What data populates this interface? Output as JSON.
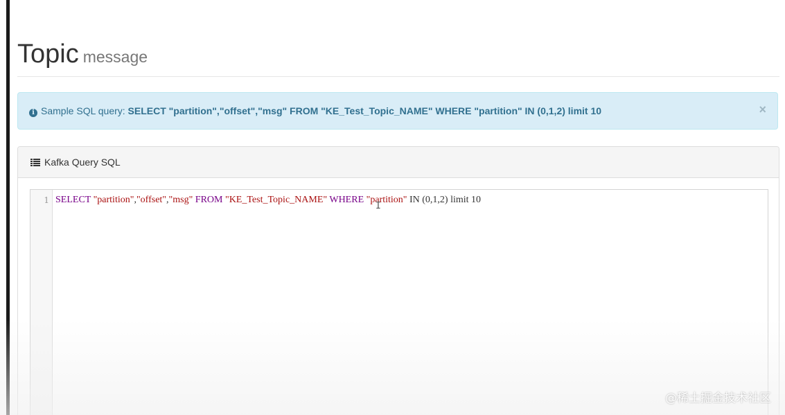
{
  "header": {
    "title": "Topic",
    "subtitle": "message"
  },
  "alert": {
    "icon": "info-circle-icon",
    "label": "Sample SQL query: ",
    "sql": "SELECT \"partition\",\"offset\",\"msg\" FROM \"KE_Test_Topic_NAME\" WHERE \"partition\" IN (0,1,2) limit 10",
    "close": "×",
    "colors": {
      "background": "#d9edf7",
      "border": "#bce8f1",
      "text": "#31708f"
    }
  },
  "panel": {
    "icon": "list-icon",
    "title": "Kafka Query SQL"
  },
  "editor": {
    "line_number": "1",
    "tokens": [
      {
        "text": "SELECT",
        "type": "kw"
      },
      {
        "text": " ",
        "type": "plain"
      },
      {
        "text": "\"partition\"",
        "type": "str"
      },
      {
        "text": ",",
        "type": "plain"
      },
      {
        "text": "\"offset\"",
        "type": "str"
      },
      {
        "text": ",",
        "type": "plain"
      },
      {
        "text": "\"msg\"",
        "type": "str"
      },
      {
        "text": " ",
        "type": "plain"
      },
      {
        "text": "FROM",
        "type": "kw"
      },
      {
        "text": " ",
        "type": "plain"
      },
      {
        "text": "\"KE_Test_Topic_NAME\"",
        "type": "str"
      },
      {
        "text": " ",
        "type": "plain"
      },
      {
        "text": "WHERE",
        "type": "kw"
      },
      {
        "text": " ",
        "type": "plain"
      },
      {
        "text": "\"partition\"",
        "type": "str"
      },
      {
        "text": " IN (0,1,2) limit 10",
        "type": "plain"
      }
    ],
    "colors": {
      "keyword": "#770088",
      "string": "#aa1111",
      "plain": "#333333"
    }
  },
  "watermark": {
    "main": "@稀土掘金技术社区",
    "url": "https://blog.csdn.net/..."
  }
}
